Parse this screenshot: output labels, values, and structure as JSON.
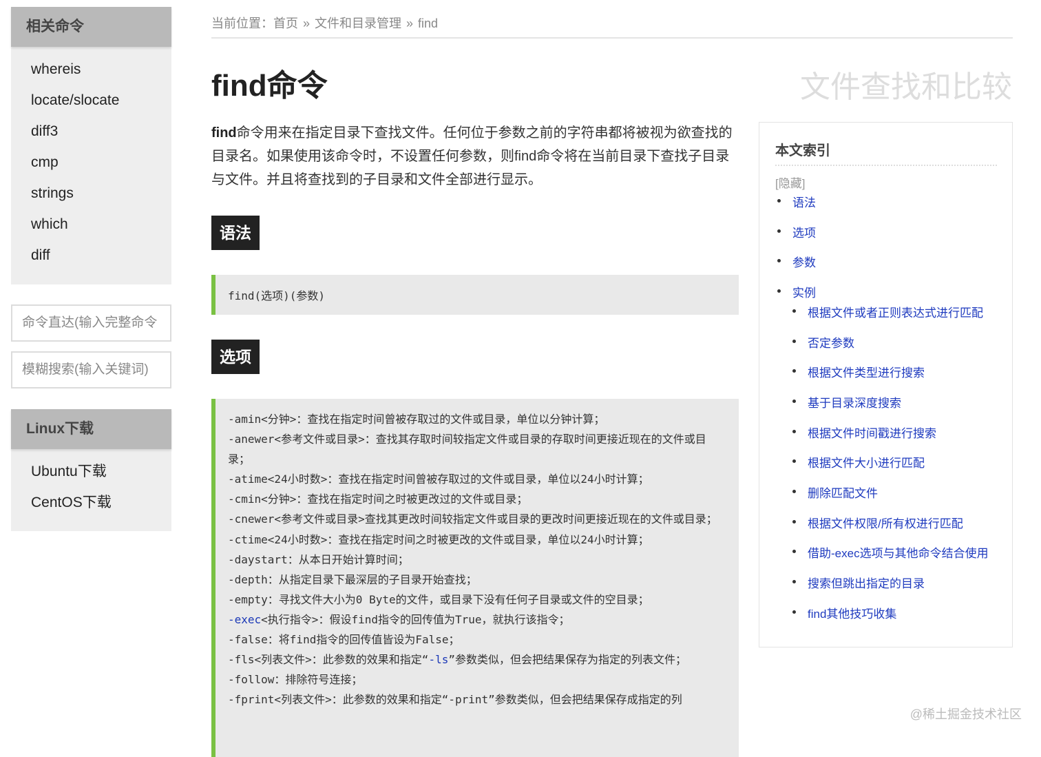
{
  "sidebar": {
    "related": {
      "title": "相关命令",
      "items": [
        "whereis",
        "locate/slocate",
        "diff3",
        "cmp",
        "strings",
        "which",
        "diff"
      ]
    },
    "search_direct_placeholder": "命令直达(输入完整命令",
    "search_fuzzy_placeholder": "模糊搜索(输入关键词)",
    "downloads": {
      "title": "Linux下载",
      "items": [
        "Ubuntu下载",
        "CentOS下载"
      ]
    }
  },
  "breadcrumb": {
    "prefix": "当前位置：",
    "items": [
      "首页",
      "文件和目录管理",
      "find"
    ],
    "separator": "»"
  },
  "main": {
    "title": "find命令",
    "category": "文件查找和比较",
    "intro_bold": "find",
    "intro_text": "命令用来在指定目录下查找文件。任何位于参数之前的字符串都将被视为欲查找的目录名。如果使用该命令时，不设置任何参数，则find命令将在当前目录下查找子目录与文件。并且将查找到的子目录和文件全部进行显示。",
    "syntax_label": "语法",
    "syntax_code": "find(选项)(参数)",
    "options_label": "选项",
    "options": [
      "-amin<分钟>：查找在指定时间曾被存取过的文件或目录，单位以分钟计算；",
      "-anewer<参考文件或目录>：查找其存取时间较指定文件或目录的存取时间更接近现在的文件或目录；",
      "-atime<24小时数>：查找在指定时间曾被存取过的文件或目录，单位以24小时计算；",
      "-cmin<分钟>：查找在指定时间之时被更改过的文件或目录；",
      "-cnewer<参考文件或目录>查找其更改时间较指定文件或目录的更改时间更接近现在的文件或目录；",
      "-ctime<24小时数>：查找在指定时间之时被更改的文件或目录，单位以24小时计算；",
      "-daystart：从本日开始计算时间；",
      "-depth：从指定目录下最深层的子目录开始查找；",
      "-empty：寻找文件大小为0 Byte的文件，或目录下没有任何子目录或文件的空目录；",
      "<执行指令>：假设find指令的回传值为True，就执行该指令；",
      "-false：将find指令的回传值皆设为False；",
      "-fls<列表文件>：此参数的效果和指定“",
      "”参数类似，但会把结果保存为指定的列表文件；",
      "-follow：排除符号连接；",
      "-fprint<列表文件>：此参数的效果和指定“-print”参数类似，但会把结果保存成指定的列"
    ],
    "option_keywords": {
      "exec": "-exec",
      "ls": "-ls"
    }
  },
  "toc": {
    "title": "本文索引",
    "hide": "[隐藏]",
    "items": [
      "语法",
      "选项",
      "参数",
      "实例"
    ],
    "sub_items": [
      "根据文件或者正则表达式进行匹配",
      "否定参数",
      "根据文件类型进行搜索",
      "基于目录深度搜索",
      "根据文件时间戳进行搜索",
      "根据文件大小进行匹配",
      "删除匹配文件",
      "根据文件权限/所有权进行匹配",
      "借助-exec选项与其他命令结合使用",
      "搜索但跳出指定的目录",
      "find其他技巧收集"
    ]
  },
  "watermark": "@稀土掘金技术社区"
}
